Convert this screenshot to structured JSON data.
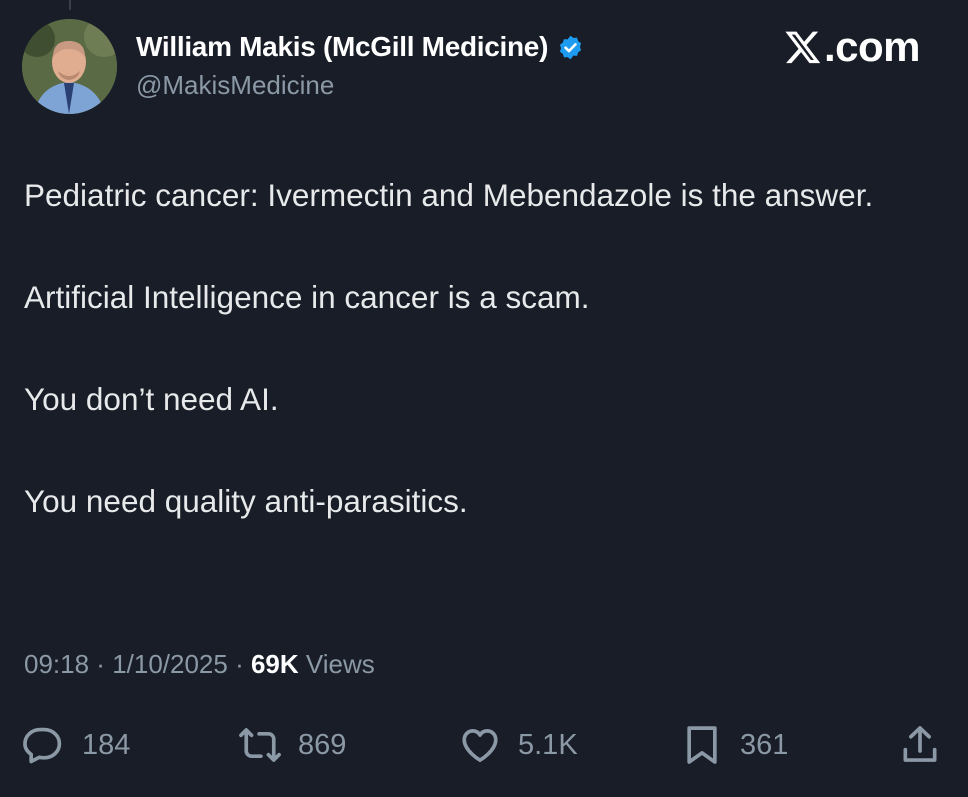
{
  "author": {
    "display_name": "William Makis (McGill Medicine)",
    "handle": "@MakisMedicine",
    "verified": true,
    "avatar": "profile-photo"
  },
  "watermark": {
    "icon": "x-logo-icon",
    "text": ".com"
  },
  "tweet": {
    "paragraphs": [
      "Pediatric cancer: Ivermectin and Mebendazole is the answer.",
      "Artificial Intelligence in cancer is a scam.",
      "You don’t need AI.",
      "You need quality anti-parasitics."
    ]
  },
  "meta": {
    "time": "09:18",
    "separator": " · ",
    "date": "1/10/2025",
    "views_count": "69K",
    "views_label": " Views"
  },
  "actions": {
    "replies": "184",
    "reposts": "869",
    "likes": "5.1K",
    "bookmarks": "361"
  },
  "colors": {
    "background": "#181d27",
    "text": "#e7e9ea",
    "muted": "#8b98a5",
    "verified": "#1d9bf0"
  }
}
